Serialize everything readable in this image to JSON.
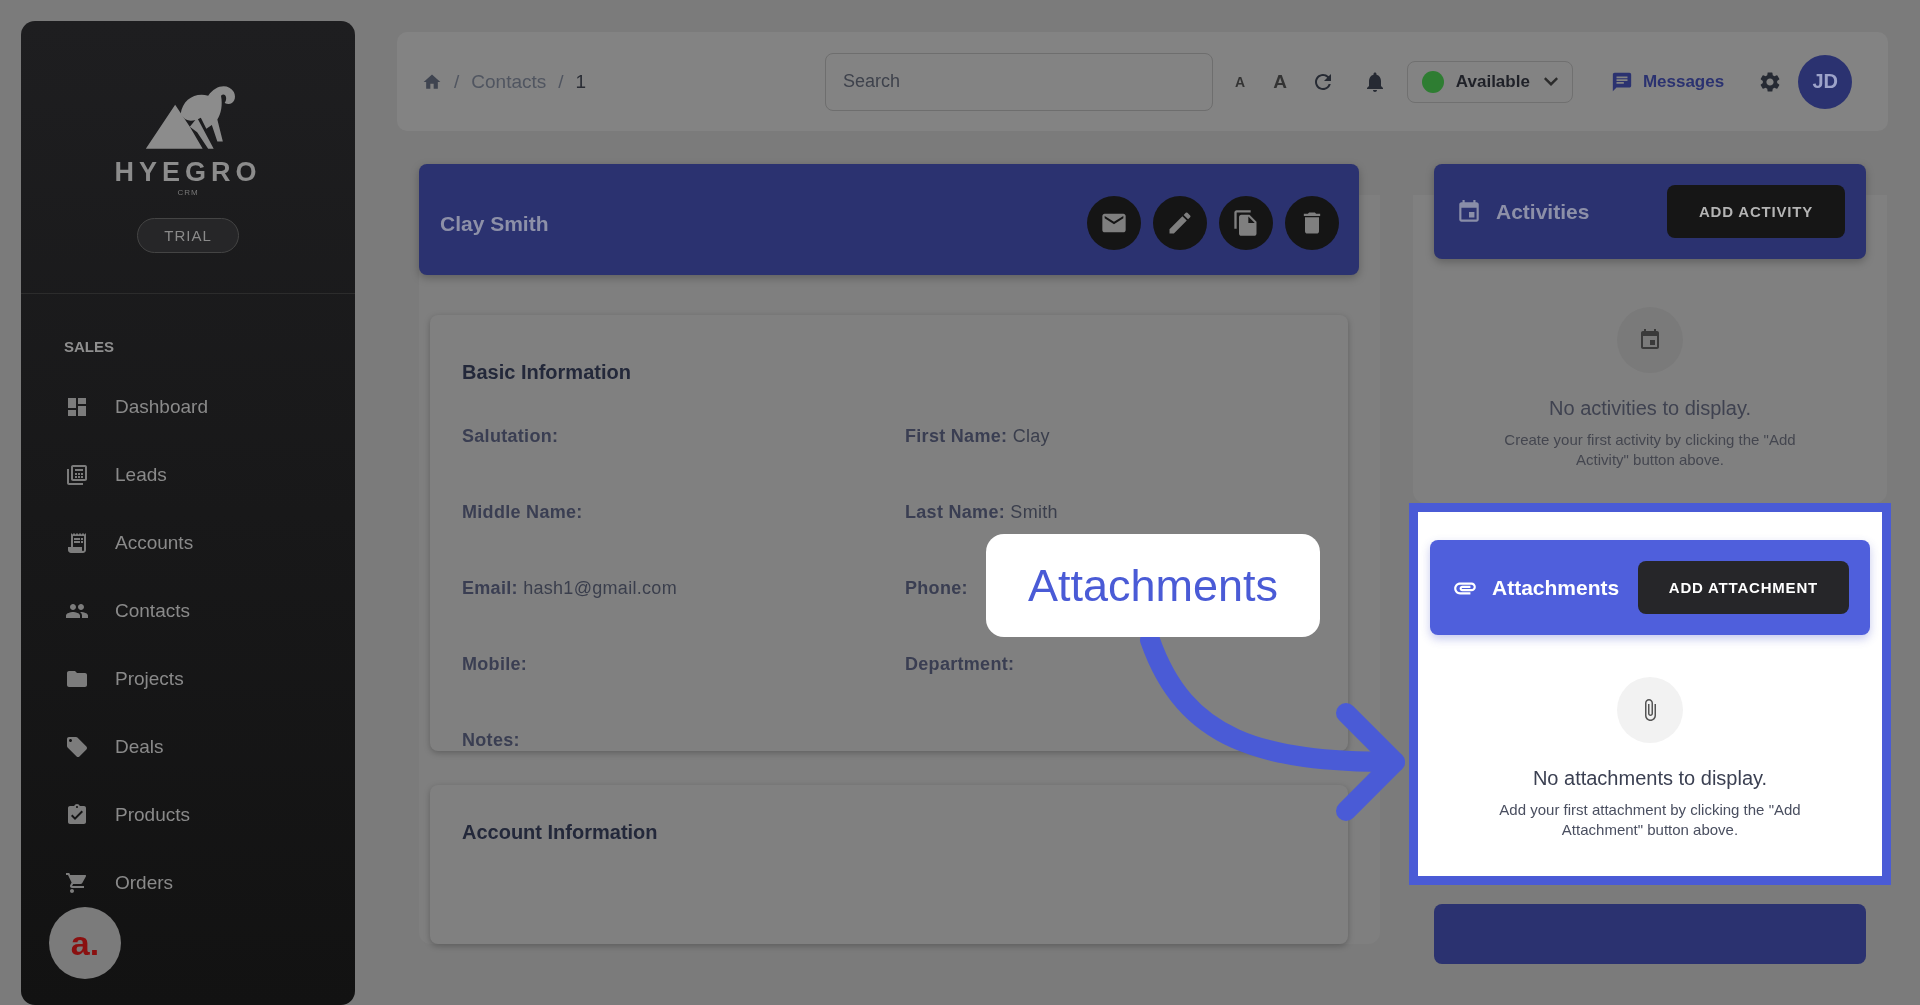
{
  "sidebar": {
    "logo": {
      "name": "HYEGRO",
      "tagline": "CRM"
    },
    "badge": "TRIAL",
    "section": "SALES",
    "items": [
      {
        "label": "Dashboard",
        "kind": "dashboard"
      },
      {
        "label": "Leads",
        "kind": "leads"
      },
      {
        "label": "Accounts",
        "kind": "accounts"
      },
      {
        "label": "Contacts",
        "kind": "contacts"
      },
      {
        "label": "Projects",
        "kind": "projects"
      },
      {
        "label": "Deals",
        "kind": "deals"
      },
      {
        "label": "Products",
        "kind": "products"
      },
      {
        "label": "Orders",
        "kind": "orders"
      }
    ],
    "launcher": {
      "label": "a."
    }
  },
  "header": {
    "breadcrumb": [
      {
        "separator": "/",
        "label": "Contacts"
      },
      {
        "separator": "/",
        "label": "1"
      }
    ],
    "search": {
      "placeholder": "Search"
    },
    "font_small": "A",
    "font_large": "A",
    "status": {
      "label": "Available"
    },
    "messages": "Messages",
    "avatar": "JD"
  },
  "contact": {
    "name": "Clay Smith",
    "actions": [
      {
        "kind": "email"
      },
      {
        "kind": "edit"
      },
      {
        "kind": "copy"
      },
      {
        "kind": "delete"
      }
    ]
  },
  "basic_info": {
    "title": "Basic Information",
    "fields": [
      {
        "label": "Salutation:"
      },
      {
        "label": "First Name:",
        "value": "Clay"
      },
      {
        "label": "Middle Name:"
      },
      {
        "label": "Last Name:",
        "value": "Smith"
      },
      {
        "label": "Email:",
        "value": "hash1@gmail.com"
      },
      {
        "label": "Phone:"
      },
      {
        "label": "Mobile:"
      },
      {
        "label": "Department:"
      },
      {
        "label": "Notes:"
      }
    ]
  },
  "account_info": {
    "title": "Account Information"
  },
  "activities": {
    "title": "Activities",
    "button": "ADD ACTIVITY",
    "empty_title": "No activities to display.",
    "empty_text": "Create your first activity by clicking the \"Add Activity\" button above.",
    "highlighted": false
  },
  "attachments": {
    "title": "Attachments",
    "button": "ADD ATTACHMENT",
    "empty_title": "No attachments to display.",
    "empty_text": "Add your first attachment by clicking the \"Add Attachment\" button above.",
    "highlighted": true
  },
  "callout": {
    "label": "Attachments"
  }
}
